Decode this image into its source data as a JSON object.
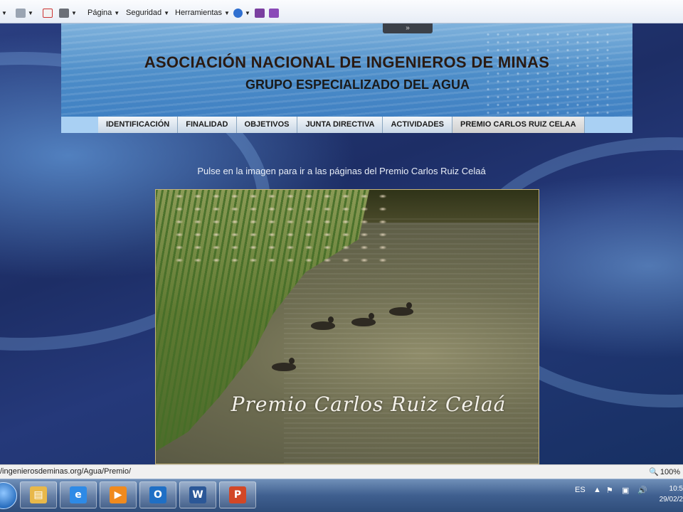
{
  "commandbar": {
    "page_label": "Página",
    "safety_label": "Seguridad",
    "tools_label": "Herramientas"
  },
  "header": {
    "title": "ASOCIACIÓN NACIONAL DE INGENIEROS DE MINAS",
    "subtitle": "GRUPO ESPECIALIZADO DEL AGUA",
    "handle_glyph": "»"
  },
  "nav": {
    "items": [
      {
        "label": "IDENTIFICACIÓN"
      },
      {
        "label": "FINALIDAD"
      },
      {
        "label": "OBJETIVOS"
      },
      {
        "label": "JUNTA DIRECTIVA"
      },
      {
        "label": "ACTIVIDADES"
      },
      {
        "label": "PREMIO CARLOS RUIZ CELAA"
      }
    ],
    "active_index": 5
  },
  "main": {
    "hint": "Pulse en la imagen para ir a las páginas del Premio Carlos Ruiz Celaá",
    "image_caption": "Premio Carlos Ruiz Celaá"
  },
  "statusbar": {
    "url": "/ingenierosdeminas.org/Agua/Premio/",
    "zoom": "100%"
  },
  "taskbar": {
    "apps": [
      {
        "icon": "file-explorer-icon",
        "glyph": "▤",
        "color": "#e8b84a"
      },
      {
        "icon": "internet-explorer-icon",
        "glyph": "e",
        "color": "#2e8ae6"
      },
      {
        "icon": "media-player-icon",
        "glyph": "▶",
        "color": "#f08a1e"
      },
      {
        "icon": "outlook-icon",
        "glyph": "O",
        "color": "#1f6fc5"
      },
      {
        "icon": "word-icon",
        "glyph": "W",
        "color": "#2b5797"
      },
      {
        "icon": "powerpoint-icon",
        "glyph": "P",
        "color": "#d24726"
      }
    ],
    "language": "ES",
    "time": "10:5",
    "date": "29/02/2"
  },
  "colors": {
    "nav_bar": "#a9d0f3",
    "title_text": "#2a1a12",
    "taskbar": "#3f5f8f"
  }
}
